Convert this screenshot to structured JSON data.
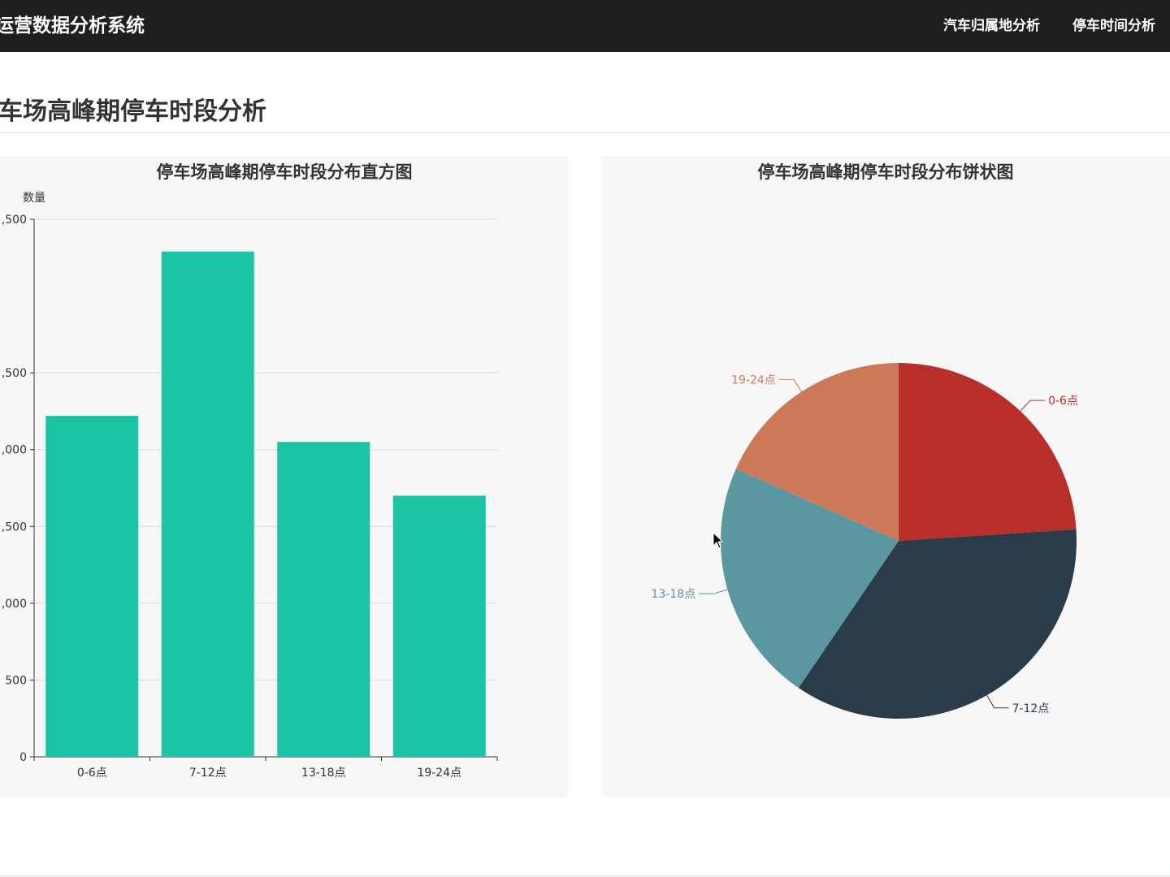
{
  "header": {
    "brand": "运营数据分析系统",
    "nav": [
      {
        "label": "汽车归属地分析"
      },
      {
        "label": "停车时间分析"
      }
    ]
  },
  "page": {
    "title": "车场高峰期停车时段分析"
  },
  "charts": {
    "bar_title": "停车场高峰期停车时段分布直方图",
    "pie_title": "停车场高峰期停车时段分布饼状图"
  },
  "chart_data": [
    {
      "type": "bar",
      "title": "停车场高峰期停车时段分布直方图",
      "ylabel": "数量",
      "xlabel": "",
      "categories": [
        "0-6点",
        "7-12点",
        "13-18点",
        "19-24点"
      ],
      "values": [
        2220,
        3290,
        2050,
        1700
      ],
      "ylim": [
        0,
        3500
      ],
      "yticks": [
        0,
        500,
        1000,
        1500,
        2000,
        2500,
        3500
      ],
      "ytick_labels": [
        "0",
        "500",
        ",000",
        ",500",
        ",000",
        ",500",
        ",500"
      ],
      "grid": true,
      "colors": {
        "bar": "#1bc4a5",
        "axis": "#333333",
        "grid": "#d8d8d8"
      }
    },
    {
      "type": "pie",
      "title": "停车场高峰期停车时段分布饼状图",
      "categories": [
        "0-6点",
        "7-12点",
        "13-18点",
        "19-24点"
      ],
      "values": [
        2220,
        3290,
        2050,
        1700
      ],
      "colors": [
        "#b82e29",
        "#2a3b4a",
        "#5b97a0",
        "#cc7959"
      ],
      "start": "top",
      "direction": "clockwise"
    }
  ]
}
